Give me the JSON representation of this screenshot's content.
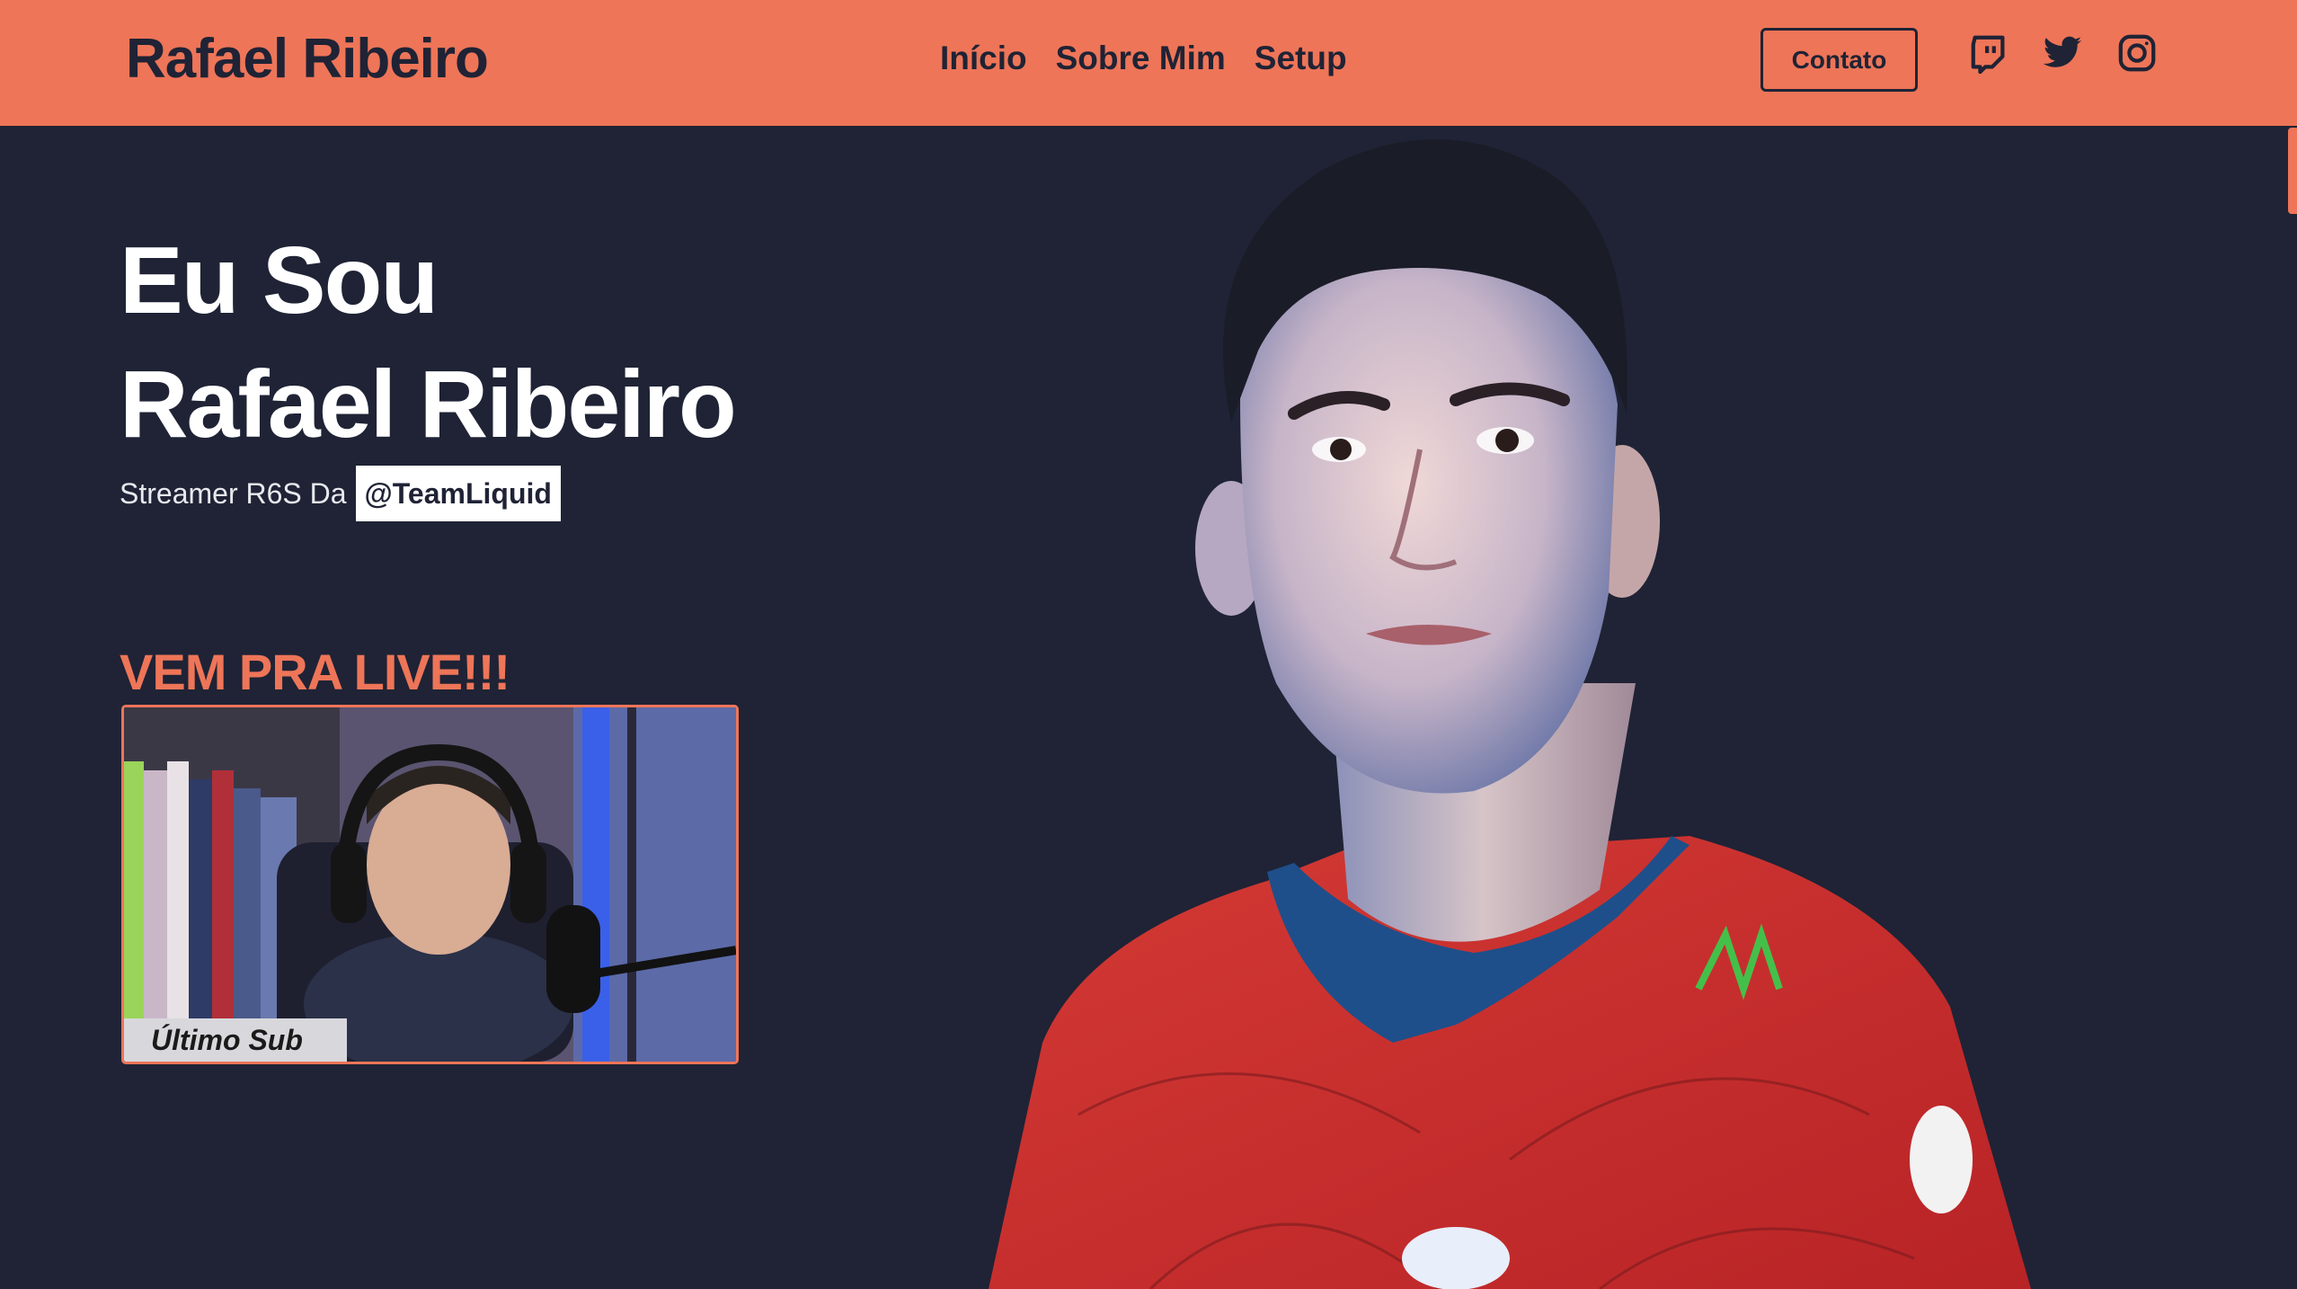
{
  "header": {
    "brand": "Rafael Ribeiro",
    "nav": [
      {
        "label": "Início"
      },
      {
        "label": "Sobre Mim"
      },
      {
        "label": "Setup"
      }
    ],
    "contact_label": "Contato",
    "social_icons": [
      "twitch-icon",
      "twitter-icon",
      "instagram-icon"
    ]
  },
  "hero": {
    "line1": "Eu Sou",
    "line2": "Rafael Ribeiro",
    "subtitle": "Streamer R6S Da",
    "team_tag": "@TeamLiquid"
  },
  "live": {
    "heading": "VEM PRA LIVE!!!",
    "overlay_label": "Último Sub"
  },
  "colors": {
    "accent": "#ee7558",
    "background": "#1f2335",
    "text_light": "#ffffff"
  }
}
